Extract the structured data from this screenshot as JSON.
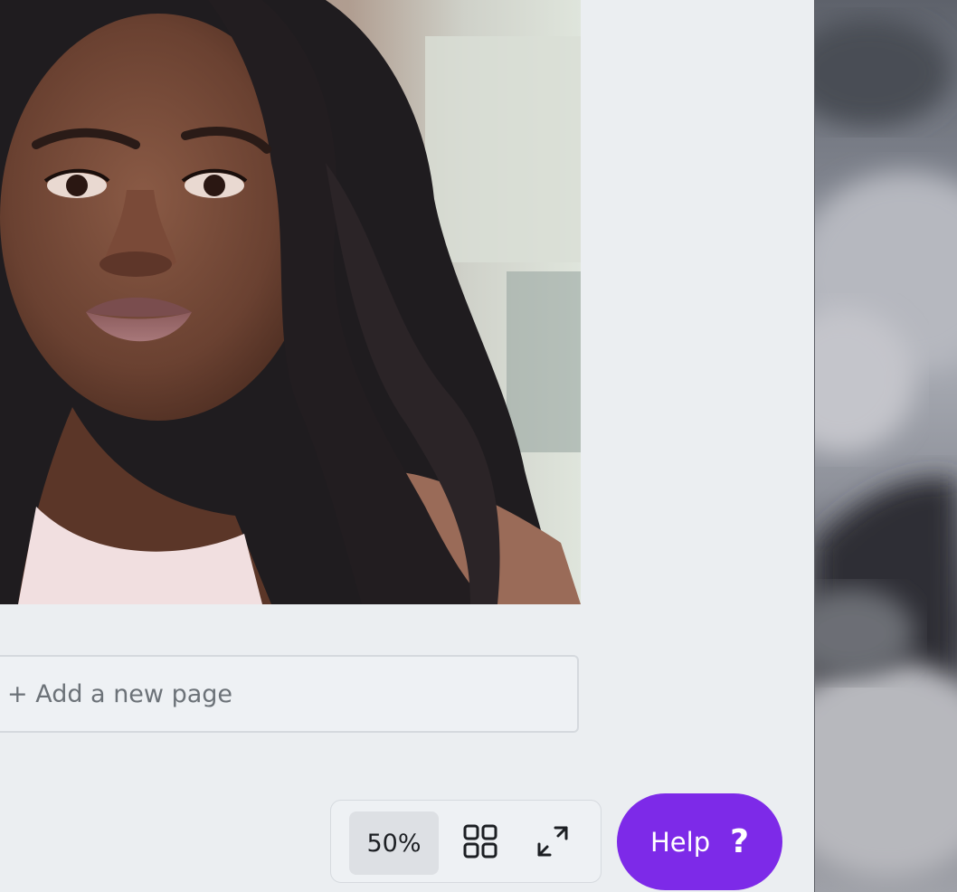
{
  "canvas": {
    "add_page_label": "+ Add a new page"
  },
  "zoom_controls": {
    "zoom_value": "50%",
    "grid_icon": "grid-view-icon",
    "expand_icon": "fullscreen-expand-icon"
  },
  "help": {
    "label": "Help",
    "icon_glyph": "?"
  },
  "colors": {
    "background": "#ebeef1",
    "help_button": "#7d2ae8"
  }
}
